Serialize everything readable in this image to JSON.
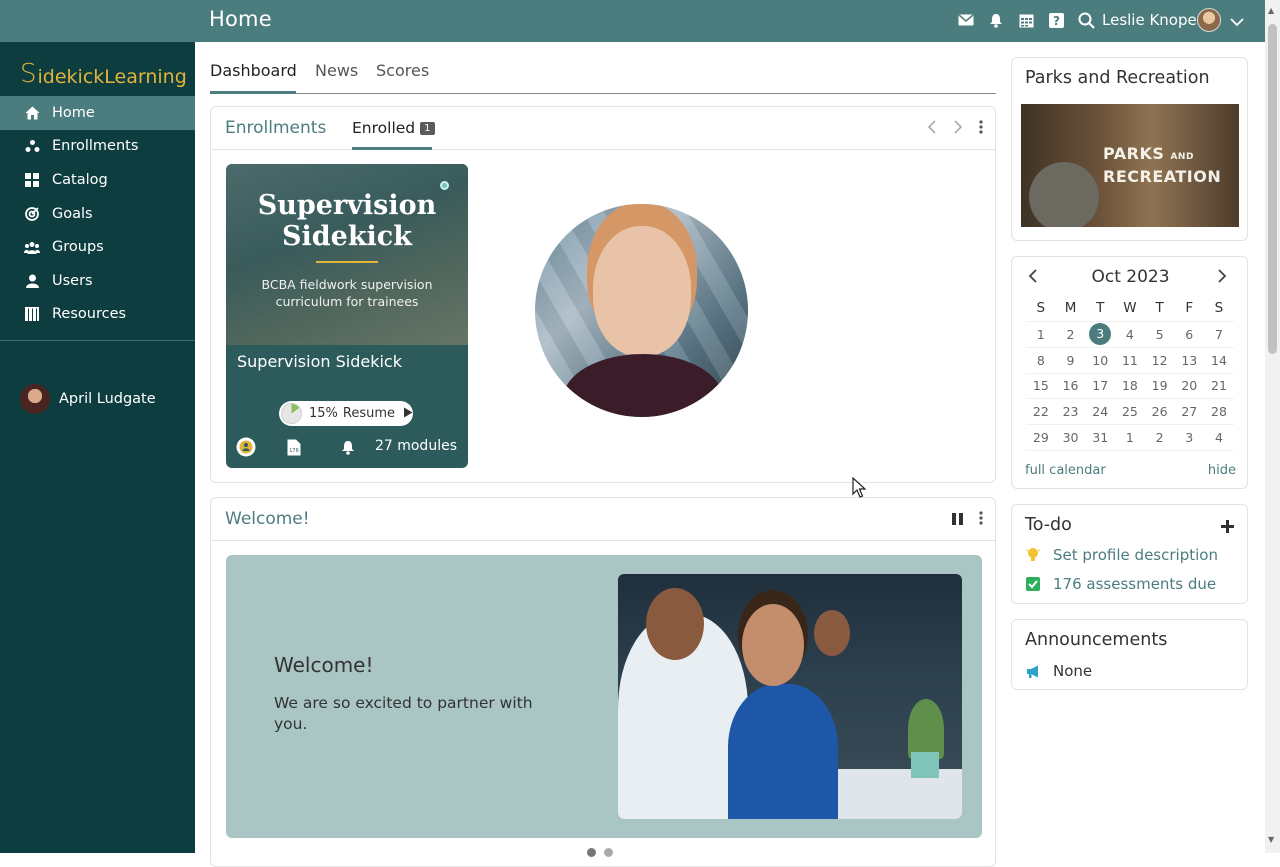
{
  "header": {
    "title": "Home",
    "user_name": "Leslie Knope",
    "icons": [
      "mail-icon",
      "bell-icon",
      "calendar-icon",
      "help-icon",
      "search-icon"
    ]
  },
  "sidebar": {
    "logo": {
      "first_letter": "S",
      "word1": "idekick",
      "word2": "Learning"
    },
    "items": [
      {
        "label": "Home",
        "icon": "home-icon",
        "active": true
      },
      {
        "label": "Enrollments",
        "icon": "enrollments-icon"
      },
      {
        "label": "Catalog",
        "icon": "catalog-icon"
      },
      {
        "label": "Goals",
        "icon": "goals-icon"
      },
      {
        "label": "Groups",
        "icon": "groups-icon"
      },
      {
        "label": "Users",
        "icon": "user-icon"
      },
      {
        "label": "Resources",
        "icon": "resources-icon"
      }
    ],
    "user": "April Ludgate"
  },
  "main": {
    "tabs": [
      "Dashboard",
      "News",
      "Scores"
    ],
    "active_tab": "Dashboard"
  },
  "enrollments": {
    "tab1": "Enrollments",
    "tab2": "Enrolled",
    "count": "1",
    "course": {
      "image_title_line1": "Supervision",
      "image_title_line2": "Sidekick",
      "image_subtitle": "BCBA fieldwork supervision curriculum for trainees",
      "title": "Supervision Sidekick",
      "progress_percent": 15,
      "progress_label": "15%",
      "resume_label": "Resume",
      "modules_label": "27 modules",
      "doc_badge": "176"
    }
  },
  "welcome": {
    "panel_title": "Welcome!",
    "heading": "Welcome!",
    "text": "We are so excited to partner with you."
  },
  "parks": {
    "title": "Parks and Recreation",
    "image_text_line1": "PARKS",
    "image_text_and": "AND",
    "image_text_line2": "RECREATION"
  },
  "calendar": {
    "month": "Oct 2023",
    "dow": [
      "S",
      "M",
      "T",
      "W",
      "T",
      "F",
      "S"
    ],
    "weeks": [
      [
        "1",
        "2",
        "3",
        "4",
        "5",
        "6",
        "7"
      ],
      [
        "8",
        "9",
        "10",
        "11",
        "12",
        "13",
        "14"
      ],
      [
        "15",
        "16",
        "17",
        "18",
        "19",
        "20",
        "21"
      ],
      [
        "22",
        "23",
        "24",
        "25",
        "26",
        "27",
        "28"
      ],
      [
        "29",
        "30",
        "31",
        "1",
        "2",
        "3",
        "4"
      ]
    ],
    "today": "3",
    "full_calendar": "full calendar",
    "hide": "hide"
  },
  "todo": {
    "title": "To-do",
    "items": [
      {
        "label": "Set profile description",
        "icon": "lightbulb-icon"
      },
      {
        "label": "176 assessments due",
        "icon": "checkbox-icon"
      }
    ]
  },
  "announcements": {
    "title": "Announcements",
    "item": "None"
  },
  "colors": {
    "teal": "#4c7d7e",
    "sidebar": "#0e3d40",
    "accent_gold": "#e0b43a"
  }
}
